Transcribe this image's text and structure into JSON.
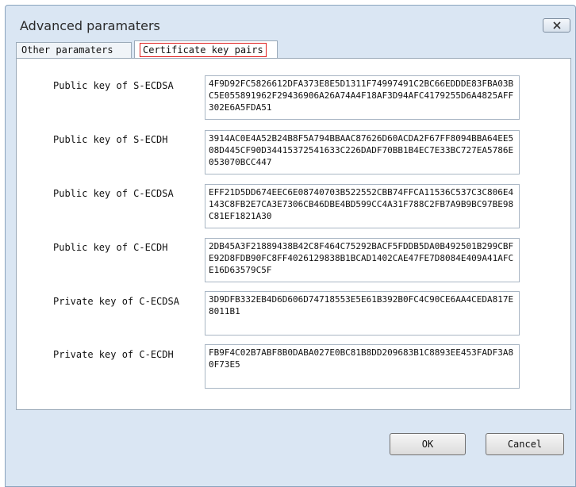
{
  "window": {
    "title": "Advanced paramaters"
  },
  "tabs": [
    {
      "label": "Other paramaters"
    },
    {
      "label": "Certificate key pairs"
    }
  ],
  "keys": [
    {
      "label": "Public key of S-ECDSA",
      "value": "4F9D92FC5826612DFA373E8E5D1311F74997491C2BC66EDDDE83FBA03BC5E055891962F29436906A26A74A4F18AF3D94AFC4179255D6A4825AFF302E6A5FDA51"
    },
    {
      "label": "Public key of S-ECDH",
      "value": "3914AC0E4A52B24B8F5A794BBAAC87626D60ACDA2F67FF8094BBA64EE508D445CF90D34415372541633C226DADF70BB1B4EC7E33BC727EA5786E053070BCC447"
    },
    {
      "label": "Public key of C-ECDSA",
      "value": "EFF21D5DD674EEC6E08740703B522552CBB74FFCA11536C537C3C806E4143C8FB2E7CA3E7306CB46DBE4BD599CC4A31F788C2FB7A9B9BC97BE98C81EF1821A30"
    },
    {
      "label": "Public key of C-ECDH",
      "value": "2DB45A3F21889438B42C8F464C75292BACF5FDDB5DA0B492501B299CBFE92D8FDB90FC8FF4026129838B1BCAD1402CAE47FE7D8084E409A41AFCE16D63579C5F"
    },
    {
      "label": "Private key of C-ECDSA",
      "value": "3D9DFB332EB4D6D606D74718553E5E61B392B0FC4C90CE6AA4CEDA817E8011B1"
    },
    {
      "label": "Private key of C-ECDH",
      "value": "FB9F4C02B7ABF8B0DABA027E0BC81B8DD209683B1C8893EE453FADF3A80F73E5"
    }
  ],
  "buttons": {
    "ok": "OK",
    "cancel": "Cancel"
  }
}
